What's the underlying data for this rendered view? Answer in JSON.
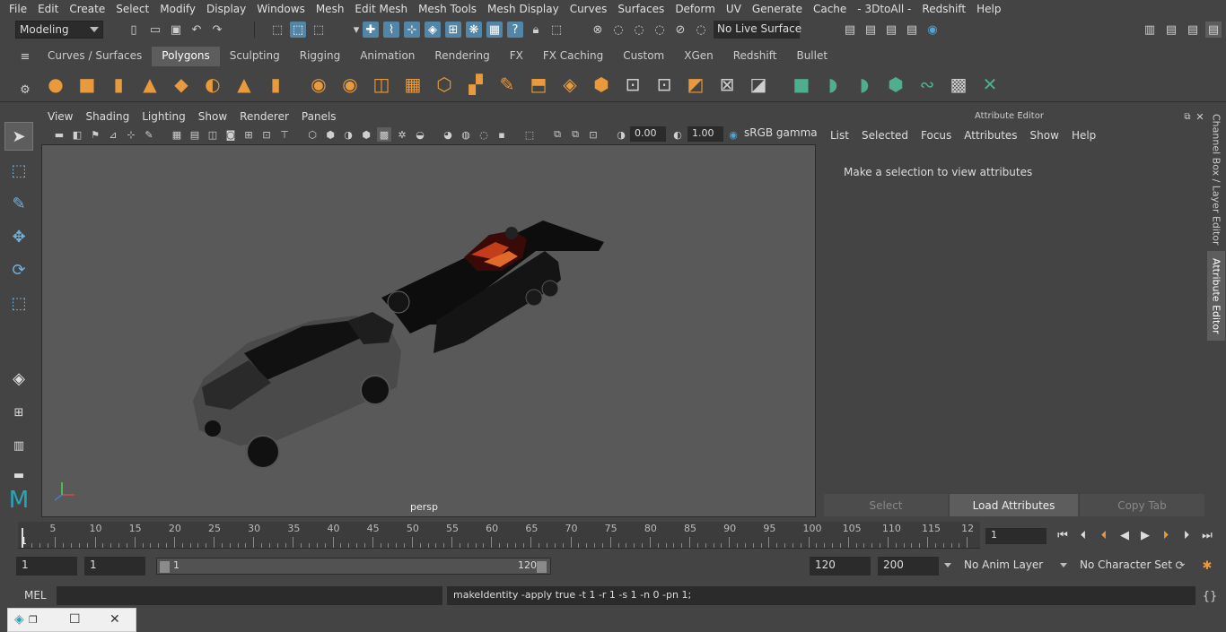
{
  "menubar": [
    "File",
    "Edit",
    "Create",
    "Select",
    "Modify",
    "Display",
    "Windows",
    "Mesh",
    "Edit Mesh",
    "Mesh Tools",
    "Mesh Display",
    "Curves",
    "Surfaces",
    "Deform",
    "UV",
    "Generate",
    "Cache",
    "- 3DtoAll -",
    "Redshift",
    "Help"
  ],
  "status": {
    "mode": "Modeling",
    "live_surface": "No Live Surface"
  },
  "shelf_tabs": [
    "Curves / Surfaces",
    "Polygons",
    "Sculpting",
    "Rigging",
    "Animation",
    "Rendering",
    "FX",
    "FX Caching",
    "Custom",
    "XGen",
    "Redshift",
    "Bullet"
  ],
  "viewport": {
    "menu": [
      "View",
      "Shading",
      "Lighting",
      "Show",
      "Renderer",
      "Panels"
    ],
    "exposure": "0.00",
    "gamma_value": "1.00",
    "color_space": "sRGB gamma",
    "camera": "persp"
  },
  "attribute_editor": {
    "title": "Attribute Editor",
    "menu": [
      "List",
      "Selected",
      "Focus",
      "Attributes",
      "Show",
      "Help"
    ],
    "message": "Make a selection to view attributes",
    "buttons": {
      "select": "Select",
      "load": "Load Attributes",
      "copy": "Copy Tab"
    }
  },
  "side_tabs": {
    "channel_box": "Channel Box / Layer Editor",
    "attribute_editor": "Attribute Editor"
  },
  "timeline": {
    "ticks": [
      "5",
      "10",
      "15",
      "20",
      "25",
      "30",
      "35",
      "40",
      "45",
      "50",
      "55",
      "60",
      "65",
      "70",
      "75",
      "80",
      "85",
      "90",
      "95",
      "100",
      "105",
      "110",
      "115",
      "12"
    ],
    "current_marker": "1",
    "current_frame": "1"
  },
  "range": {
    "start": "1",
    "inner_start": "1",
    "slider_start": "1",
    "slider_end": "120",
    "inner_end": "120",
    "end": "200",
    "anim_layer": "No Anim Layer",
    "character_set": "No Character Set"
  },
  "command": {
    "language": "MEL",
    "result": "makeIdentity -apply true -t 1 -r 1 -s 1 -n 0 -pn 1;"
  },
  "colors": {
    "accent": "#5285a6",
    "shelf_green": "#4fae8e",
    "shelf_orange": "#e89a3c"
  }
}
